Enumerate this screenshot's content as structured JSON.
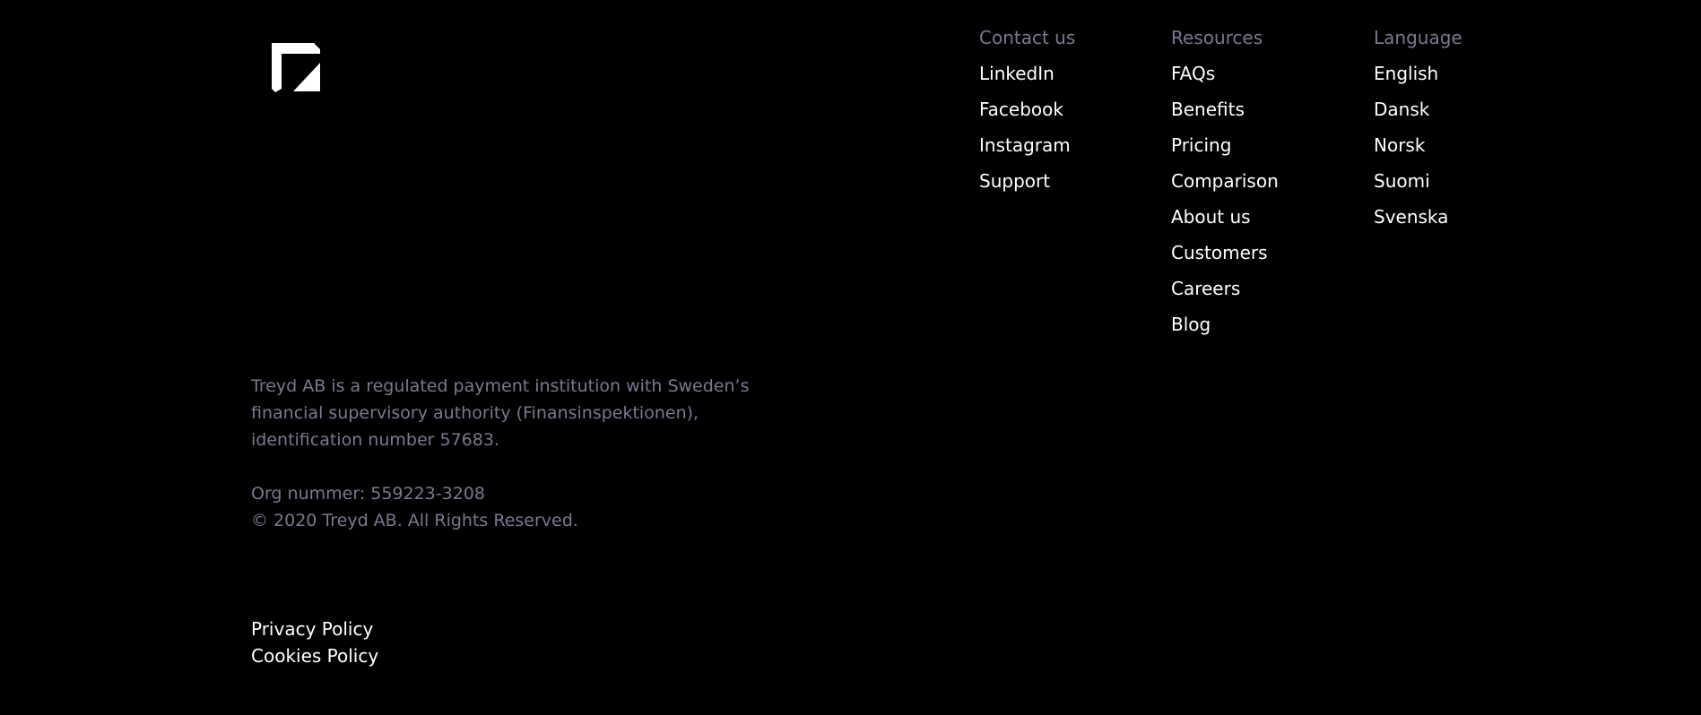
{
  "brand": {
    "logo_icon": "treyd-logo-icon",
    "colors": {
      "background": "#000000",
      "link": "#ffffff",
      "muted": "#7a7890"
    }
  },
  "columns": {
    "contact": {
      "heading": "Contact us",
      "links": [
        "LinkedIn",
        "Facebook",
        "Instagram",
        "Support"
      ]
    },
    "resources": {
      "heading": "Resources",
      "links": [
        "FAQs",
        "Benefits",
        "Pricing",
        "Comparison",
        "About us",
        "Customers",
        "Careers",
        "Blog"
      ]
    },
    "language": {
      "heading": "Language",
      "links": [
        "English",
        "Dansk",
        "Norsk",
        "Suomi",
        "Svenska"
      ]
    }
  },
  "legal": {
    "text": "Treyd AB is a regulated payment institution with Sweden’s financial supervisory authority (Finansinspektionen), identification number 57683.",
    "org_number": "Org nummer: 559223-3208",
    "copyright": "© 2020 Treyd AB. All Rights Reserved."
  },
  "policies": {
    "privacy": "Privacy Policy",
    "cookies": "Cookies Policy"
  }
}
